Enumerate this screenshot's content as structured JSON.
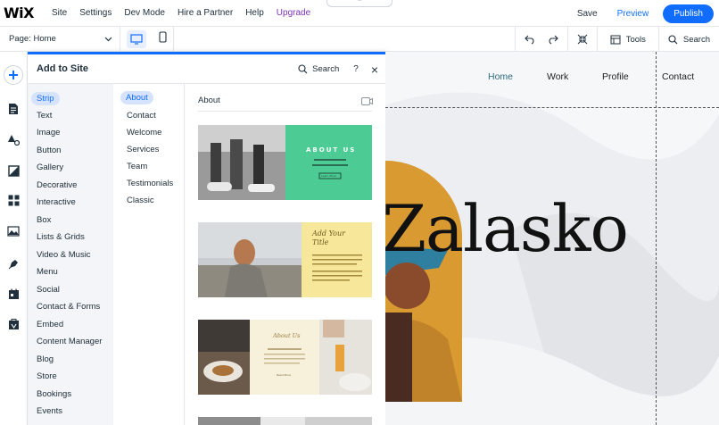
{
  "topbar": {
    "logo": "WiX",
    "menu": [
      "Site",
      "Settings",
      "Dev Mode",
      "Hire a Partner",
      "Help",
      "Upgrade"
    ],
    "save": "Save",
    "preview": "Preview",
    "publish": "Publish",
    "collapse_glyph": "⌃"
  },
  "secondbar": {
    "page_label": "Page: Home",
    "tools": "Tools",
    "search": "Search"
  },
  "panel": {
    "title": "Add to Site",
    "search": "Search",
    "help": "?",
    "close": "×",
    "categories": [
      "Strip",
      "Text",
      "Image",
      "Button",
      "Gallery",
      "Decorative",
      "Interactive",
      "Box",
      "Lists & Grids",
      "Video & Music",
      "Menu",
      "Social",
      "Contact & Forms",
      "Embed",
      "Content Manager",
      "Blog",
      "Store",
      "Bookings",
      "Events"
    ],
    "selected_category": "Strip",
    "subcategories": [
      "About",
      "Contact",
      "Welcome",
      "Services",
      "Team",
      "Testimonials",
      "Classic"
    ],
    "selected_subcategory": "About",
    "section_title": "About",
    "cards": [
      {
        "heading": "ABOUT US",
        "button": "Learn More"
      },
      {
        "heading": "Add Your Title"
      },
      {
        "heading": "About Us",
        "button": "Read More"
      }
    ]
  },
  "canvas": {
    "nav": [
      "Home",
      "Work",
      "Profile",
      "Contact"
    ],
    "active_nav": "Home",
    "hero_text": "Zalasko"
  },
  "colors": {
    "accent": "#116dff",
    "upgrade": "#7a33b8",
    "active_nav": "#2d6b80",
    "card1_bg": "#4dcb94",
    "card2_bg": "#f7e79a",
    "card3_bg": "#f7f0da",
    "arch": "#d99a32"
  }
}
